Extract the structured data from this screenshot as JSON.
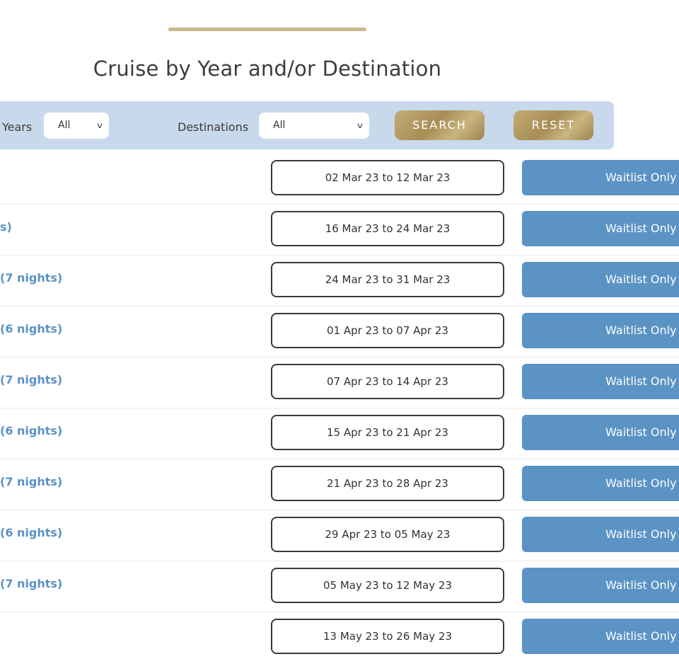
{
  "header": {
    "title": "Cruise by Year and/or Destination"
  },
  "filters": {
    "years_label": "Years",
    "years_value": "All",
    "destinations_label": "Destinations",
    "destinations_value": "All",
    "search_label": "SEARCH",
    "reset_label": "RESET",
    "chevron_icon": "chevron-down-icon"
  },
  "cruises": [
    {
      "title": "",
      "dates": "02 Mar 23 to 12 Mar 23",
      "status": "Waitlist Only"
    },
    {
      "title": "s)",
      "dates": "16 Mar 23 to 24 Mar 23",
      "status": "Waitlist Only"
    },
    {
      "title": "(7 nights)",
      "dates": "24 Mar 23 to 31 Mar 23",
      "status": "Waitlist Only"
    },
    {
      "title": "(6 nights)",
      "dates": "01 Apr 23 to 07 Apr 23",
      "status": "Waitlist Only"
    },
    {
      "title": "(7 nights)",
      "dates": "07 Apr 23 to 14 Apr 23",
      "status": "Waitlist Only"
    },
    {
      "title": "(6 nights)",
      "dates": "15 Apr 23 to 21 Apr 23",
      "status": "Waitlist Only"
    },
    {
      "title": "(7 nights)",
      "dates": "21 Apr 23 to 28 Apr 23",
      "status": "Waitlist Only"
    },
    {
      "title": "(6 nights)",
      "dates": "29 Apr 23 to 05 May 23",
      "status": "Waitlist Only"
    },
    {
      "title": "(7 nights)",
      "dates": "05 May 23 to 12 May 23",
      "status": "Waitlist Only"
    },
    {
      "title": "",
      "dates": "13 May 23 to 26 May 23",
      "status": "Waitlist Only"
    }
  ],
  "colors": {
    "accent_gold": "#c8b98c",
    "filter_bg": "#c8d9ec",
    "link_blue": "#5b92c4",
    "waitlist_blue": "#5b93c4"
  }
}
